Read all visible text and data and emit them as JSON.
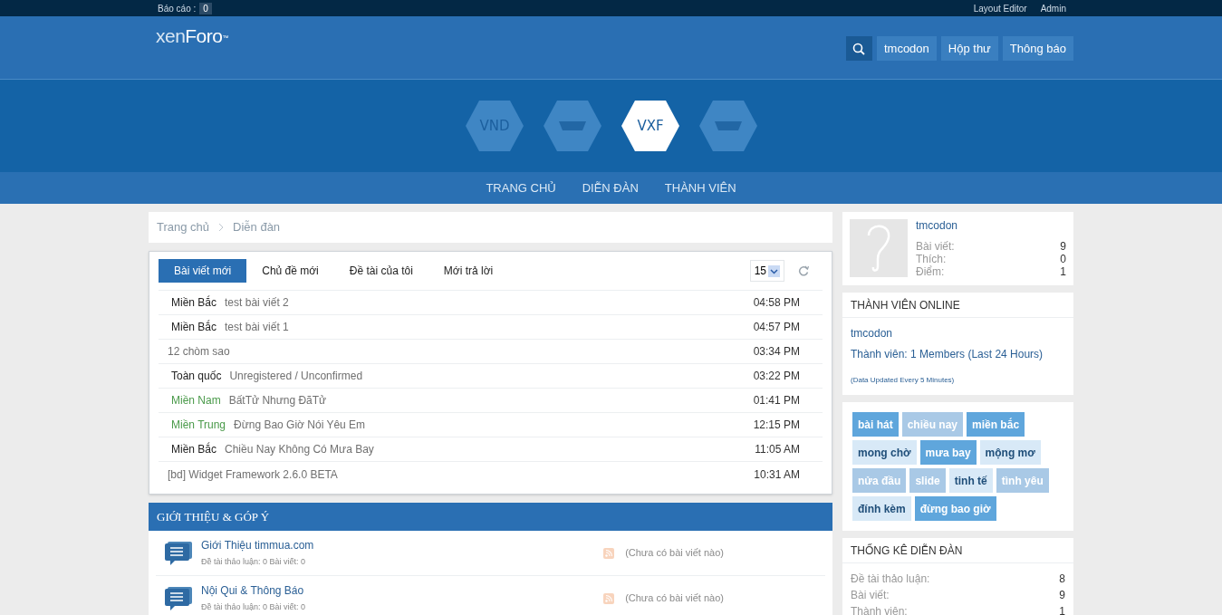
{
  "top_bar": {
    "report_label": "Báo cáo :",
    "report_count": "0",
    "links": [
      "Layout Editor",
      "Admin"
    ]
  },
  "header": {
    "logo": {
      "part1": "xen",
      "part2": "Foro",
      "mark": "™"
    },
    "buttons": [
      "tmcodon",
      "Hộp thư",
      "Thông báo"
    ]
  },
  "site_logos": [
    {
      "label": "VND",
      "selected": false
    },
    {
      "selected": false
    },
    {
      "label": "VXF",
      "selected": true
    },
    {
      "selected": false
    }
  ],
  "nav": [
    "TRANG CHỦ",
    "DIỄN ĐÀN",
    "THÀNH VIÊN"
  ],
  "breadcrumb": [
    "Trang chủ",
    "Diễn đàn"
  ],
  "new_posts": {
    "tabs": [
      {
        "label": "Bài viết mới",
        "selected": true
      },
      {
        "label": "Chủ đề mới",
        "selected": false
      },
      {
        "label": "Đề tài của tôi",
        "selected": false
      },
      {
        "label": "Mới trả lời",
        "selected": false
      }
    ],
    "limit": "15",
    "rows": [
      {
        "prefix": "Miền Bắc",
        "color": "#222222",
        "title": "test bài viết 2",
        "time": "04:58 PM"
      },
      {
        "prefix": "Miền Bắc",
        "color": "#222222",
        "title": "test bài viết 1",
        "time": "04:57 PM"
      },
      {
        "title": "12 chòm sao",
        "time": "03:34 PM"
      },
      {
        "prefix": "Toàn quốc",
        "color": "#222222",
        "title": "Unregistered / Unconfirmed",
        "time": "03:22 PM"
      },
      {
        "prefix": "Miền Nam",
        "color": "#4a9a4a",
        "title": "BấtTử Nhưng ĐãTử",
        "time": "01:41 PM"
      },
      {
        "prefix": "Miền Trung",
        "color": "#4a9a4a",
        "title": "Đừng Bao Giờ Nói Yêu Em",
        "time": "12:15 PM"
      },
      {
        "prefix": "Miền Bắc",
        "color": "#222222",
        "title": "Chiều Nay Không Có Mưa Bay",
        "time": "11:05 AM"
      },
      {
        "title": "[bd] Widget Framework 2.6.0 BETA",
        "time": "10:31 AM"
      }
    ]
  },
  "category": {
    "title": "GIỚI THIỆU & GÓP Ý",
    "forums": [
      {
        "name": "Giới Thiệu timmua.com",
        "stats": "Đề tài thảo luận: 0 Bài viết: 0",
        "last_post": "(Chưa có bài viết nào)"
      },
      {
        "name": "Nội Qui & Thông Báo",
        "stats": "Đề tài thảo luận: 0 Bài viết: 0",
        "last_post": "(Chưa có bài viết nào)"
      }
    ]
  },
  "sidebar": {
    "profile": {
      "username": "tmcodon",
      "stats": [
        {
          "label": "Bài viết:",
          "value": "9"
        },
        {
          "label": "Thích:",
          "value": "0"
        },
        {
          "label": "Điểm:",
          "value": "1"
        }
      ]
    },
    "online": {
      "title": "THÀNH VIÊN ONLINE",
      "members": "tmcodon",
      "summary": "Thành viên: 1 Members (Last 24 Hours)",
      "note": "(Data Updated Every 5 Minutes)"
    },
    "tags": [
      {
        "label": "bài hát",
        "kind": "strong"
      },
      {
        "label": "chiều nay",
        "kind": "medium"
      },
      {
        "label": "miền bắc",
        "kind": "strong"
      },
      {
        "label": "mong chờ",
        "kind": "light"
      },
      {
        "label": "mưa bay",
        "kind": "strong"
      },
      {
        "label": "mộng mơ",
        "kind": "light"
      },
      {
        "label": "nửa đầu",
        "kind": "medium"
      },
      {
        "label": "slide",
        "kind": "medium"
      },
      {
        "label": "tinh tế",
        "kind": "light"
      },
      {
        "label": "tình yêu",
        "kind": "medium"
      },
      {
        "label": "đính kèm",
        "kind": "light"
      },
      {
        "label": "đừng bao giờ",
        "kind": "strong"
      }
    ],
    "forum_stats": {
      "title": "THỐNG KÊ DIỄN ĐÀN",
      "stats": [
        {
          "label": "Đề tài thảo luận:",
          "value": "8"
        },
        {
          "label": "Bài viết:",
          "value": "9"
        },
        {
          "label": "Thành viên:",
          "value": "1"
        }
      ]
    }
  }
}
